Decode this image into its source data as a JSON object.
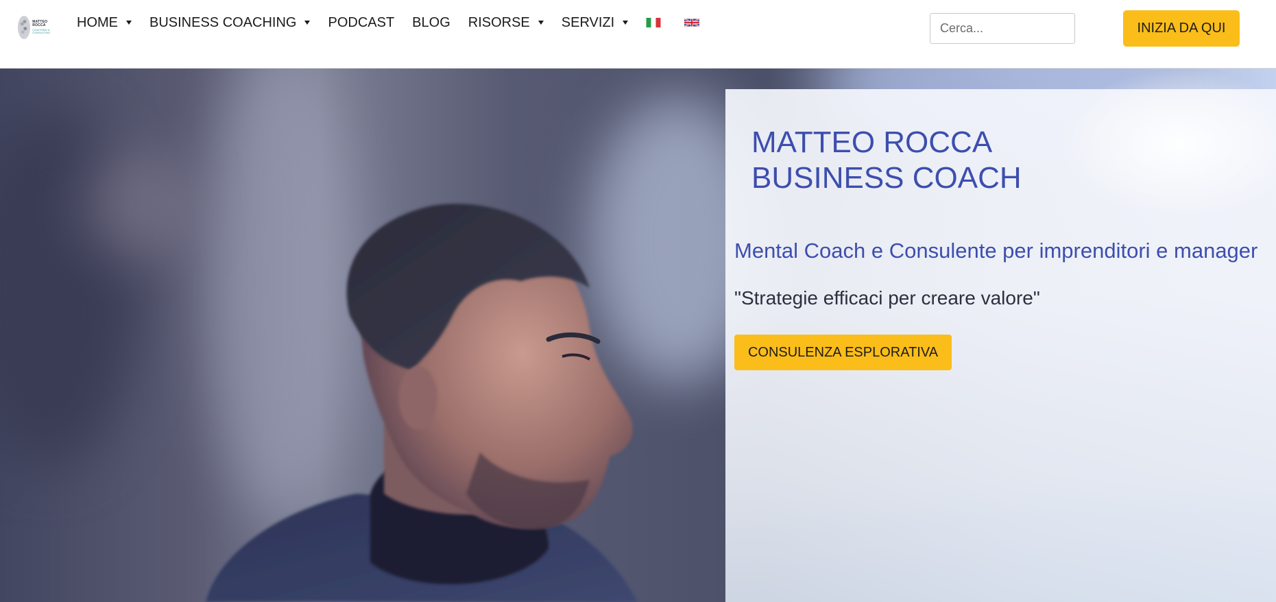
{
  "brand": {
    "name": "MATTEO ROCCA",
    "tagline": "COACHING & CONSULTING"
  },
  "nav": {
    "items": [
      {
        "label": "HOME",
        "has_dropdown": true
      },
      {
        "label": "BUSINESS COACHING",
        "has_dropdown": true
      },
      {
        "label": "PODCAST",
        "has_dropdown": false
      },
      {
        "label": "BLOG",
        "has_dropdown": false
      },
      {
        "label": "RISORSE",
        "has_dropdown": true
      },
      {
        "label": "SERVIZI",
        "has_dropdown": true
      }
    ],
    "flags": [
      "italian-flag-icon",
      "uk-flag-icon"
    ]
  },
  "search": {
    "placeholder": "Cerca..."
  },
  "header_cta": {
    "label": "INIZIA DA QUI"
  },
  "hero": {
    "title_line1": "MATTEO ROCCA",
    "title_line2": "BUSINESS COACH",
    "subtitle": "Mental Coach e Consulente per imprenditori e manager",
    "quote": "\"Strategie efficaci per creare valore\"",
    "cta_label": "CONSULENZA ESPLORATIVA"
  },
  "colors": {
    "accent": "#fbbd1a",
    "title_blue": "#3c4eae",
    "text_dark": "#2c2f3e"
  }
}
